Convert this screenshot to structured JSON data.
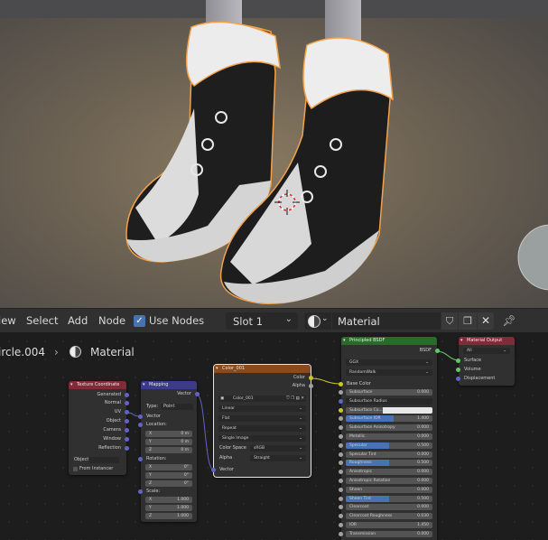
{
  "header": {
    "menu": [
      "iew",
      "Select",
      "Add",
      "Node"
    ],
    "use_nodes_label": "Use Nodes",
    "slot": "Slot 1",
    "material": "Material"
  },
  "breadcrumb": {
    "object": "ircle.004",
    "material": "Material"
  },
  "nodes": {
    "texcoord": {
      "title": "Texture Coordinate",
      "outputs": [
        "Generated",
        "Normal",
        "UV",
        "Object",
        "Camera",
        "Window",
        "Reflection"
      ],
      "object_label": "Object:",
      "from_instancer": "From Instancer"
    },
    "mapping": {
      "title": "Mapping",
      "vector_out": "Vector",
      "type_label": "Type:",
      "type_value": "Point",
      "vector_in": "Vector",
      "location": "Location:",
      "loc": [
        "X",
        "0 m",
        "Y",
        "0 m",
        "Z",
        "0 m"
      ],
      "rotation": "Rotation:",
      "rot": [
        "X",
        "0°",
        "Y",
        "0°",
        "Z",
        "0°"
      ],
      "scale": "Scale:",
      "scl": [
        "X",
        "1.000",
        "Y",
        "1.000",
        "Z",
        "1.000"
      ]
    },
    "image": {
      "title": "Color_001",
      "color_out": "Color",
      "alpha_out": "Alpha",
      "image_name": "Color_001",
      "interp": "Linear",
      "proj": "Flat",
      "ext": "Repeat",
      "source": "Single Image",
      "cs_label": "Color Space",
      "cs_value": "sRGB",
      "alpha_label": "Alpha",
      "alpha_value": "Straight",
      "vector_in": "Vector"
    },
    "bsdf": {
      "title": "Principled BSDF",
      "bsdf_out": "BSDF",
      "dist": "GGX",
      "sss_method": "RandomWalk",
      "base_color": "Base Color",
      "rows": [
        [
          "Subsurface",
          "0.000"
        ],
        [
          "Subsurface Radius",
          ""
        ],
        [
          "Subsurface Co...",
          ""
        ],
        [
          "Subsurface IOR",
          "1.400"
        ],
        [
          "Subsurface Anisotropy",
          "0.000"
        ],
        [
          "Metallic",
          "0.000"
        ],
        [
          "Specular",
          "0.500"
        ],
        [
          "Specular Tint",
          "0.000"
        ],
        [
          "Roughness",
          "0.500"
        ],
        [
          "Anisotropic",
          "0.000"
        ],
        [
          "Anisotropic Rotation",
          "0.000"
        ],
        [
          "Sheen",
          "0.000"
        ],
        [
          "Sheen Tint",
          "0.500"
        ],
        [
          "Clearcoat",
          "0.000"
        ],
        [
          "Clearcoat Roughness",
          "0.030"
        ],
        [
          "IOR",
          "1.450"
        ],
        [
          "Transmission",
          "0.000"
        ]
      ]
    },
    "output": {
      "title": "Material Output",
      "target": "All",
      "inputs": [
        "Surface",
        "Volume",
        "Displacement"
      ]
    }
  }
}
